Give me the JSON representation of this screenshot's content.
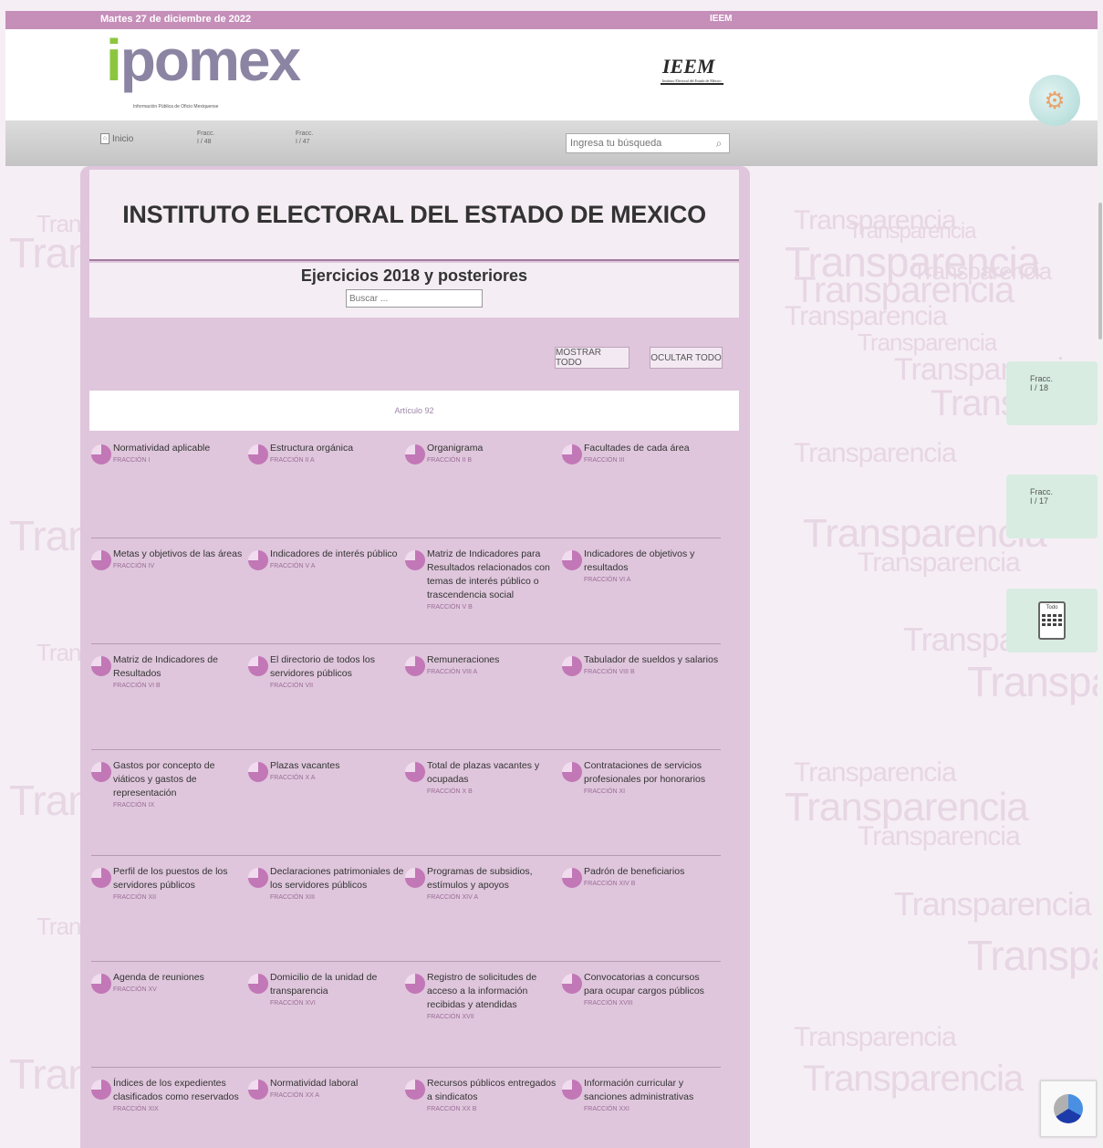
{
  "topbar": {
    "date": "Martes 27 de diciembre de 2022",
    "center_label": "IEEM"
  },
  "header": {
    "logo_main": "pomex",
    "logo_i": "i",
    "logo_tagline": "Información Pública de Oficio Mexiquense",
    "ieem_logo": "IEEM",
    "ieem_sub": "Instituto Electoral del Estado de México"
  },
  "nav": {
    "inicio": "Inicio",
    "fracc_1_label": "Fracc.",
    "fracc_1_value": "I / 48",
    "fracc_2_label": "Fracc.",
    "fracc_2_value": "I / 47",
    "search_placeholder": "Ingresa tu búsqueda"
  },
  "main": {
    "title": "INSTITUTO ELECTORAL DEL ESTADO DE MEXICO",
    "subtitle": "Ejercicios 2018 y posteriores",
    "buscar_placeholder": "Buscar ...",
    "mostrar_todo": "MOSTRAR TODO",
    "ocultar_todo": "OCULTAR TODO",
    "article": "Artículo 92"
  },
  "items": [
    [
      {
        "label": "Normatividad aplicable",
        "fraccion": "FRACCIÓN I"
      },
      {
        "label": "Estructura orgánica",
        "fraccion": "FRACCIÓN II A"
      },
      {
        "label": "Organigrama",
        "fraccion": "FRACCIÓN II B"
      },
      {
        "label": "Facultades de cada área",
        "fraccion": "FRACCIÓN III"
      }
    ],
    [
      {
        "label": "Metas y objetivos de las áreas",
        "fraccion": "FRACCIÓN IV"
      },
      {
        "label": "Indicadores de interés público",
        "fraccion": "FRACCIÓN V A"
      },
      {
        "label": "Matriz de Indicadores para Resultados relacionados con temas de interés público o trascendencia social",
        "fraccion": "FRACCIÓN V B"
      },
      {
        "label": "Indicadores de objetivos y resultados",
        "fraccion": "FRACCIÓN VI A"
      }
    ],
    [
      {
        "label": "Matriz de Indicadores de Resultados",
        "fraccion": "FRACCIÓN VI B"
      },
      {
        "label": "El directorio de todos los servidores públicos",
        "fraccion": "FRACCIÓN VII"
      },
      {
        "label": "Remuneraciones",
        "fraccion": "FRACCIÓN VIII A"
      },
      {
        "label": "Tabulador de sueldos y salarios",
        "fraccion": "FRACCIÓN VIII B"
      }
    ],
    [
      {
        "label": "Gastos por concepto de viáticos y gastos de representación",
        "fraccion": "FRACCIÓN IX"
      },
      {
        "label": "Plazas vacantes",
        "fraccion": "FRACCIÓN X A"
      },
      {
        "label": "Total de plazas vacantes y ocupadas",
        "fraccion": "FRACCIÓN X B"
      },
      {
        "label": "Contrataciones de servicios profesionales por honorarios",
        "fraccion": "FRACCIÓN XI"
      }
    ],
    [
      {
        "label": "Perfil de los puestos de los servidores públicos",
        "fraccion": "FRACCIÓN XII"
      },
      {
        "label": "Declaraciones patrimoniales de los servidores públicos",
        "fraccion": "FRACCIÓN XIII"
      },
      {
        "label": "Programas de subsidios, estímulos y apoyos",
        "fraccion": "FRACCIÓN XIV A"
      },
      {
        "label": "Padrón de beneficiarios",
        "fraccion": "FRACCIÓN XIV B"
      }
    ],
    [
      {
        "label": "Agenda de reuniones",
        "fraccion": "FRACCIÓN XV"
      },
      {
        "label": "Domicilio de la unidad de transparencia",
        "fraccion": "FRACCIÓN XVI"
      },
      {
        "label": "Registro de solicitudes de acceso a la información recibidas y atendidas",
        "fraccion": "FRACCIÓN XVII"
      },
      {
        "label": "Convocatorias a concursos para ocupar cargos públicos",
        "fraccion": "FRACCIÓN XVIII"
      }
    ],
    [
      {
        "label": "Índices de los expedientes clasificados como reservados",
        "fraccion": "FRACCIÓN XIX"
      },
      {
        "label": "Normatividad laboral",
        "fraccion": "FRACCIÓN XX A"
      },
      {
        "label": "Recursos públicos entregados a sindicatos",
        "fraccion": "FRACCIÓN XX B"
      },
      {
        "label": "Información curricular y sanciones administrativas",
        "fraccion": "FRACCIÓN XXI"
      }
    ]
  ],
  "side": {
    "widget_1_title": "Fracc.",
    "widget_1_value": "I / 18",
    "widget_2_title": "Fracc.",
    "widget_2_value": "I / 17",
    "calc_label": "Todo"
  },
  "watermark_word": "Transparencia"
}
